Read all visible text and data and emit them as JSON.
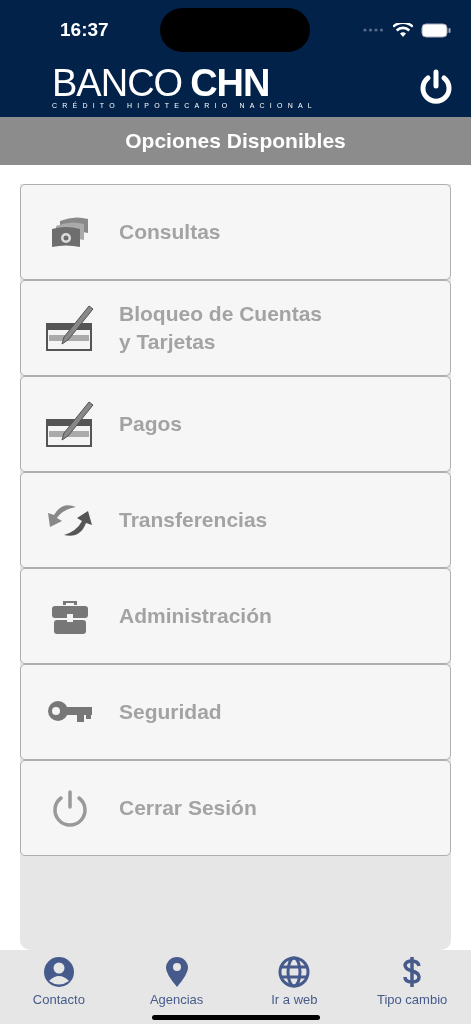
{
  "status_bar": {
    "time": "16:37"
  },
  "header": {
    "logo_left": "BANCO",
    "logo_right": "CHN",
    "logo_tagline": "CRÉDITO HIPOTECARIO NACIONAL"
  },
  "section_title": "Opciones Disponibles",
  "menu": [
    {
      "label": "Consultas"
    },
    {
      "label": "Bloqueo de Cuentas\ny Tarjetas"
    },
    {
      "label": "Pagos"
    },
    {
      "label": "Transferencias"
    },
    {
      "label": "Administración"
    },
    {
      "label": "Seguridad"
    },
    {
      "label": "Cerrar Sesión"
    }
  ],
  "tab_bar": [
    {
      "label": "Contacto"
    },
    {
      "label": "Agencias"
    },
    {
      "label": "Ir a web"
    },
    {
      "label": "Tipo cambio"
    }
  ]
}
